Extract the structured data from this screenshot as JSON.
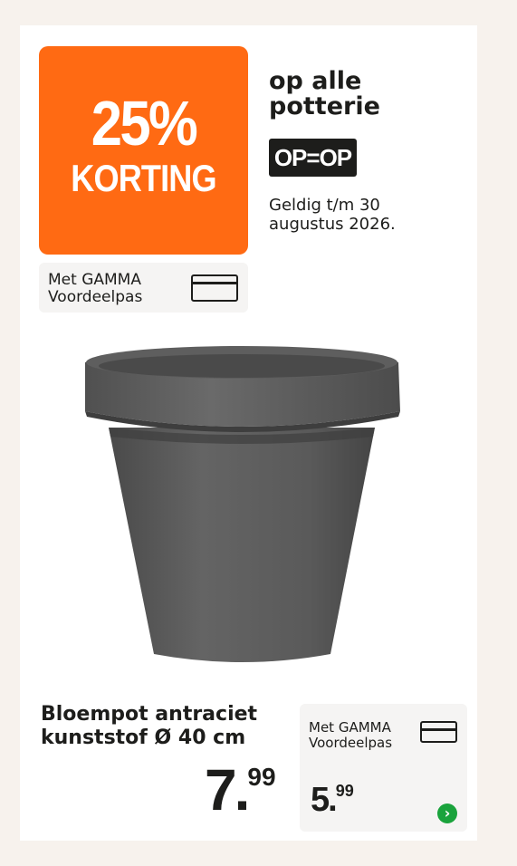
{
  "promo": {
    "percent": "25%",
    "discount_word": "KORTING",
    "card_label_line1": "Met GAMMA",
    "card_label_line2": "Voordeelpas"
  },
  "headline": {
    "line1": "op alle",
    "line2": "potterie"
  },
  "op_op_badge": "OP=OP",
  "validity": {
    "line1": "Geldig t/m 30",
    "line2": "augustus 2026."
  },
  "product": {
    "title_line1": "Bloempot antraciet",
    "title_line2": "kunststof Ø 40 cm",
    "price_main": "7.",
    "price_decimals": "99",
    "image_name": "anthracite-plant-pot",
    "pot_color": "#5b5b5b"
  },
  "member_price": {
    "label_line1": "Met GAMMA",
    "label_line2": "Voordeelpas",
    "price_main": "5.",
    "price_decimals": "99"
  },
  "colors": {
    "accent_orange": "#ff6a13",
    "badge_black": "#1d1d1b",
    "arrow_green": "#1aa33c"
  }
}
